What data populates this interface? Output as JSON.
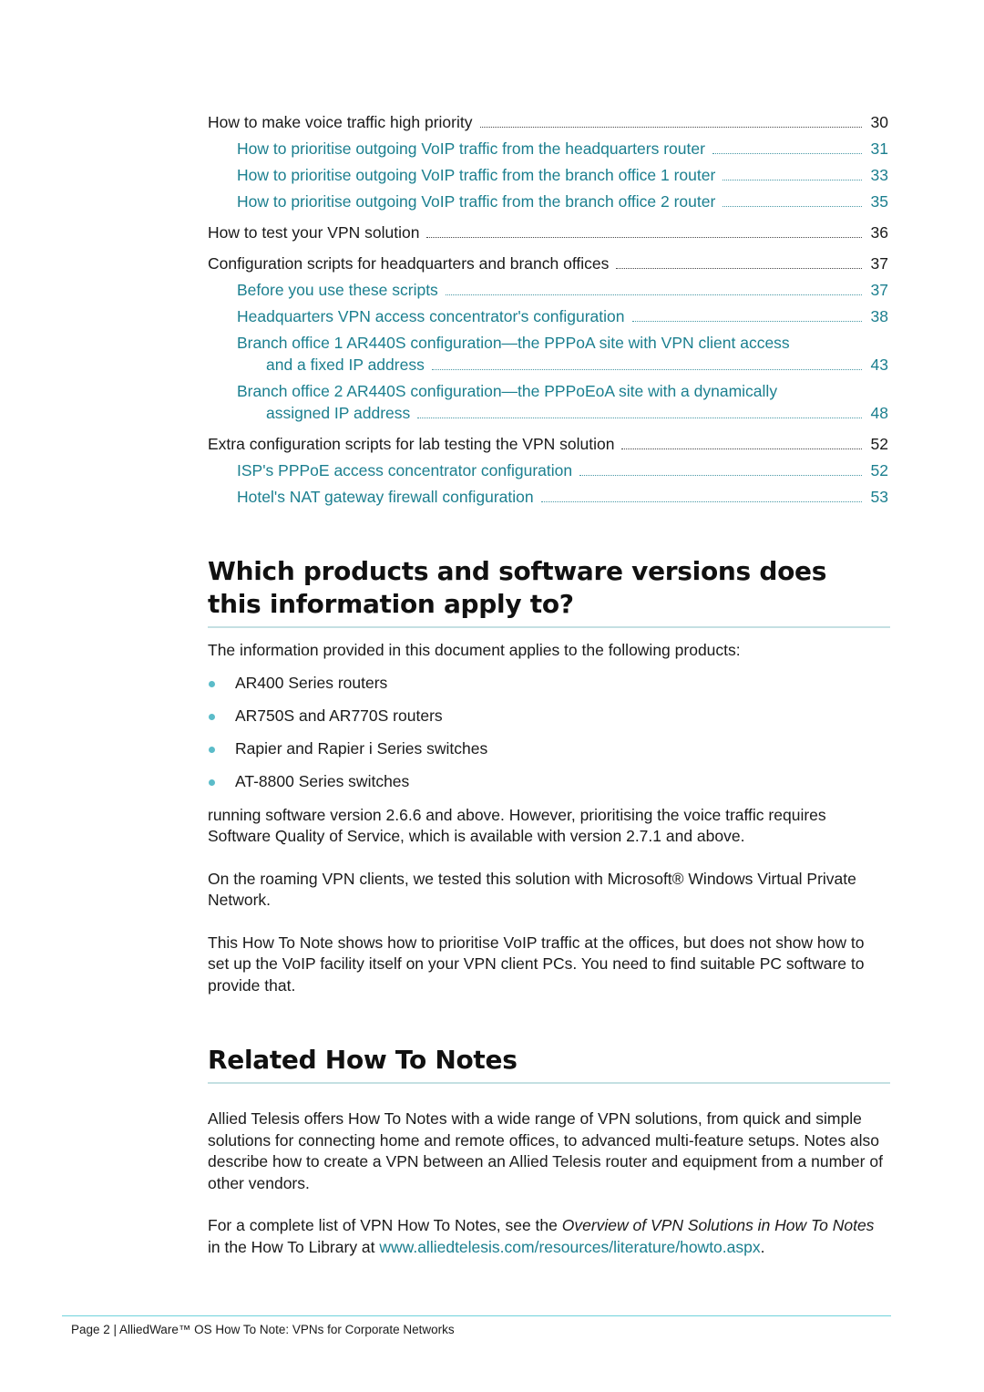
{
  "toc": {
    "entries": [
      {
        "level": 1,
        "title": "How to make voice traffic high priority",
        "page": "30"
      },
      {
        "level": 2,
        "title": "How to prioritise outgoing VoIP traffic from the headquarters router",
        "page": "31"
      },
      {
        "level": 2,
        "title": "How to prioritise outgoing VoIP traffic from the branch office 1 router",
        "page": "33"
      },
      {
        "level": 2,
        "title": "How to prioritise outgoing VoIP traffic from the branch office 2 router",
        "page": "35"
      },
      {
        "level": 1,
        "title": "How to test your VPN solution",
        "page": "36"
      },
      {
        "level": 1,
        "title": "Configuration scripts for headquarters and branch offices",
        "page": "37"
      },
      {
        "level": 2,
        "title": "Before you use these scripts",
        "page": "37"
      },
      {
        "level": 2,
        "title": "Headquarters VPN access concentrator's configuration",
        "page": "38"
      },
      {
        "level": 2,
        "title_line1": "Branch office 1 AR440S configuration—the PPPoA site with VPN client access",
        "title_line2": "and a fixed IP address",
        "page": "43"
      },
      {
        "level": 2,
        "title_line1": "Branch office 2 AR440S configuration—the PPPoEoA site with a dynamically",
        "title_line2": "assigned IP address",
        "page": "48"
      },
      {
        "level": 1,
        "title": "Extra configuration scripts for lab testing the VPN solution",
        "page": "52"
      },
      {
        "level": 2,
        "title": "ISP's PPPoE access concentrator configuration",
        "page": "52"
      },
      {
        "level": 2,
        "title": "Hotel's NAT gateway firewall configuration",
        "page": "53"
      }
    ]
  },
  "products_section": {
    "heading": "Which products and software versions does this information apply to?",
    "intro": "The information provided in this document applies to the following products:",
    "products": [
      "AR400 Series routers",
      "AR750S and AR770S routers",
      "Rapier and Rapier i Series switches",
      "AT-8800 Series switches"
    ],
    "para1": "running software version 2.6.6 and above. However, prioritising the voice traffic requires Software Quality of Service, which is available with version 2.7.1 and above.",
    "para2": "On the roaming VPN clients, we tested this solution with Microsoft® Windows Virtual Private Network.",
    "para3": "This How To Note shows how to prioritise VoIP traffic at the offices, but does not show how to set up the VoIP facility itself on your VPN client PCs. You need to find suitable PC software to provide that."
  },
  "related_section": {
    "heading": "Related How To Notes",
    "para1": "Allied Telesis offers How To Notes with a wide range of VPN solutions, from quick and simple solutions for connecting home and remote offices, to advanced multi-feature setups. Notes also describe how to create a VPN between an Allied Telesis router and equipment from a number of other vendors.",
    "para2_prefix": "For a complete list of VPN How To Notes, see the ",
    "para2_italic": "Overview of VPN Solutions in How To Notes",
    "para2_mid": " in the How To Library at ",
    "para2_link": "www.alliedtelesis.com/resources/literature/howto.aspx",
    "para2_suffix": "."
  },
  "footer": {
    "text": "Page 2 | AlliedWare™ OS How To Note: VPNs for Corporate Networks"
  },
  "colors": {
    "link_teal": "#1b7f8f",
    "bullet": "#5bbcc9",
    "heading_rule": "#c4e0e2",
    "footer_rule": "#6fd3dc"
  }
}
